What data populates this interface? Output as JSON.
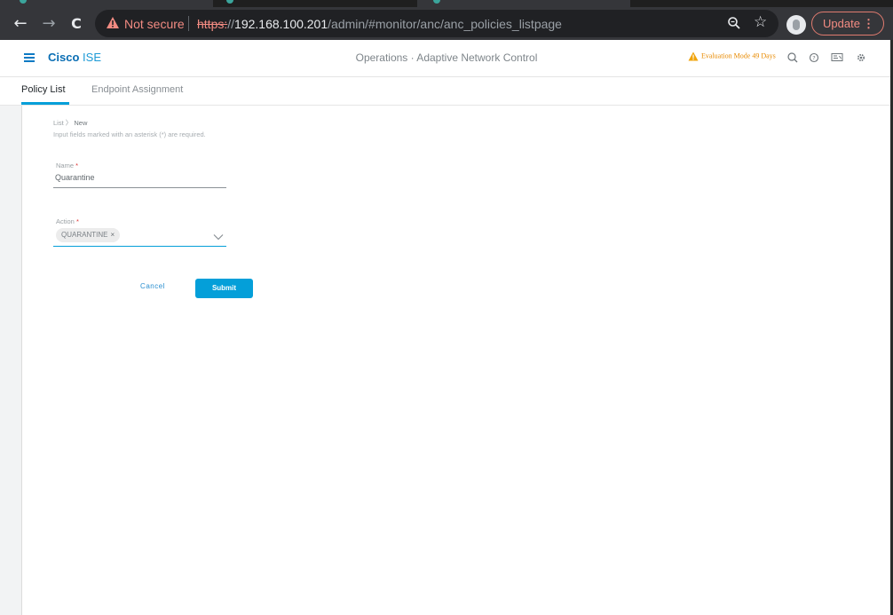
{
  "browser": {
    "security_label": "Not secure",
    "url_scheme": "https:",
    "url_slashes": "//",
    "url_host": "192.168.100.201",
    "url_path": "/admin/#monitor/anc/anc_policies_listpage",
    "update_label": "Update",
    "update_menu_glyph": "⋮",
    "back_icon": "←",
    "forward_icon": "→",
    "reload_icon": "C",
    "star_icon": "☆"
  },
  "header": {
    "brand_primary": "Cisco",
    "brand_secondary": "ISE",
    "title": "Operations · Adaptive Network Control",
    "evaluation_text": "Evaluation Mode 49 Days"
  },
  "tabs": [
    {
      "label": "Policy List",
      "active": true
    },
    {
      "label": "Endpoint Assignment",
      "active": false
    }
  ],
  "breadcrumb": {
    "parent": "List",
    "separator": "〉",
    "current": "New"
  },
  "form": {
    "required_hint": "Input fields marked with an asterisk (*) are required.",
    "name": {
      "label": "Name",
      "required_mark": "*",
      "value": "Quarantine"
    },
    "action": {
      "label": "Action",
      "required_mark": "*",
      "chips": [
        {
          "label": "QUARANTINE",
          "remove": "×"
        }
      ]
    },
    "cancel_label": "Cancel",
    "submit_label": "Submit"
  },
  "colors": {
    "accent": "#049fd9",
    "brand": "#0a6eb4",
    "warning": "#e88a00"
  }
}
